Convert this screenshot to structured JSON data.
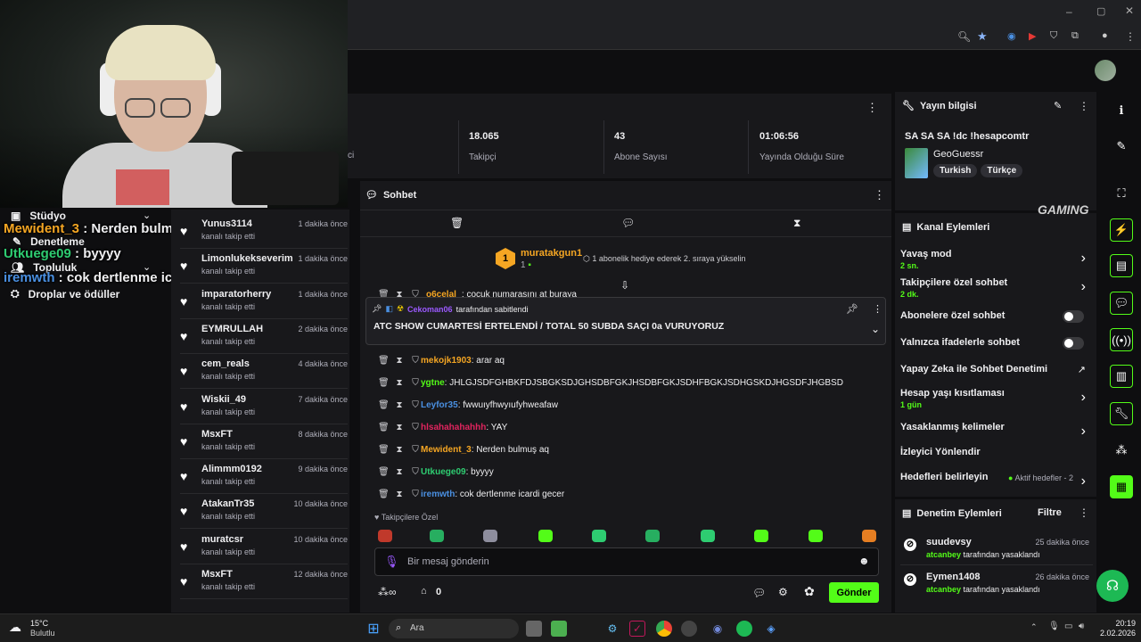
{
  "overlay_chat": [
    {
      "user": "Mewident_3",
      "text": " : Nerden bulmuş aq",
      "color": "#f5a623"
    },
    {
      "user": "Utkuege09",
      "text": " : byyyy",
      "color": "#2ecc71"
    },
    {
      "user": "iremwth",
      "text": " : cok dertlenme icardi gecer",
      "color": "#4a90e2"
    }
  ],
  "left_nav": [
    {
      "label": "Stüdyo",
      "icon": "studio-icon"
    },
    {
      "label": "Denetleme",
      "icon": "moderation-icon"
    },
    {
      "label": "Topluluk",
      "icon": "community-icon"
    },
    {
      "label": "Droplar ve ödüller",
      "icon": "drops-icon"
    }
  ],
  "followers": [
    {
      "name": "Yunus3114",
      "time": "1 dakika önce",
      "sub": "kanalı takip etti"
    },
    {
      "name": "Limonlukekseverim",
      "time": "1 dakika önce",
      "sub": "kanalı takip etti"
    },
    {
      "name": "imparatorherry",
      "time": "1 dakika önce",
      "sub": "kanalı takip etti"
    },
    {
      "name": "EYMRULLAH",
      "time": "2 dakika önce",
      "sub": "kanalı takip etti"
    },
    {
      "name": "cem_reals",
      "time": "4 dakika önce",
      "sub": "kanalı takip etti"
    },
    {
      "name": "Wiskii_49",
      "time": "7 dakika önce",
      "sub": "kanalı takip etti"
    },
    {
      "name": "MsxFT",
      "time": "8 dakika önce",
      "sub": "kanalı takip etti"
    },
    {
      "name": "Alimmm0192",
      "time": "9 dakika önce",
      "sub": "kanalı takip etti"
    },
    {
      "name": "AtakanTr35",
      "time": "10 dakika önce",
      "sub": "kanalı takip etti"
    },
    {
      "name": "muratcsr",
      "time": "10 dakika önce",
      "sub": "kanalı takip etti"
    },
    {
      "name": "MsxFT",
      "time": "12 dakika önce",
      "sub": "kanalı takip etti"
    }
  ],
  "stats": {
    "partial_label": "ci",
    "followers_value": "18.065",
    "followers_label": "Takipçi",
    "subs_value": "43",
    "subs_label": "Abone Sayısı",
    "uptime_value": "01:06:56",
    "uptime_label": "Yayında Olduğu Süre"
  },
  "chat": {
    "title": "Sohbet",
    "gifter_name": "muratakgun1",
    "gifter_count": "1",
    "gifter_rank": "1",
    "gifter_text": "1 abonelik hediye ederek 2. sıraya yükselin",
    "cut_msg_user": "o6celal",
    "cut_msg_text": ": cocuk numarasını at buraya",
    "pinned_by": "Cekoman06",
    "pinned_suffix": " tarafından sabitlendi",
    "pinned_text": "ATC SHOW CUMARTESİ ERTELENDİ / TOTAL 50 SUBDA SAÇI 0a VURUYORUZ",
    "messages": [
      {
        "user": "mekojk1903",
        "text": ": arar aq",
        "color": "#f5a623"
      },
      {
        "user": "ygtne",
        "text": ": JHLGJSDFGHBKFDJSBGKSDJGHSDBFGKJHSDBFGKJSDHFBGKJSDHGSKDJHGSDFJHGBSD",
        "color": "#53fc18"
      },
      {
        "user": "Leyfor35",
        "text": ": fwwuıyfhwyıufyhweafaw",
        "color": "#4a90e2"
      },
      {
        "user": "hlsahahahahhh",
        "text": ": YAY",
        "color": "#e0245e"
      },
      {
        "user": "Mewident_3",
        "text": ": Nerden bulmuş aq",
        "color": "#f5a623"
      },
      {
        "user": "Utkuege09",
        "text": ": byyyy",
        "color": "#2ecc71"
      },
      {
        "user": "iremwth",
        "text": ": cok dertlenme icardi gecer",
        "color": "#4a90e2"
      }
    ],
    "followers_only_label": "Takipçilere Özel",
    "input_placeholder": "Bir mesaj gönderin",
    "points_value": "0",
    "send_label": "Gönder"
  },
  "stream_info": {
    "title": "Yayın bilgisi",
    "stream_title": "SA SA SA !dc !hesapcomtr",
    "category": "GeoGuessr",
    "tags": [
      "Turkish",
      "Türkçe"
    ]
  },
  "channel_actions": {
    "title": "Kanal Eylemleri",
    "items": [
      {
        "label": "Yavaş mod",
        "sub": "2 sn.",
        "control": "chevron"
      },
      {
        "label": "Takipçilere özel sohbet",
        "sub": "2 dk.",
        "control": "chevron"
      },
      {
        "label": "Abonelere özel sohbet",
        "sub": "",
        "control": "toggle"
      },
      {
        "label": "Yalnızca ifadelerle sohbet",
        "sub": "",
        "control": "toggle"
      },
      {
        "label": "Yapay Zeka ile Sohbet Denetimi",
        "sub": "",
        "control": "external"
      },
      {
        "label": "Hesap yaşı kısıtlaması",
        "sub": "1 gün",
        "control": "chevron"
      },
      {
        "label": "Yasaklanmış kelimeler",
        "sub": "",
        "control": "chevron"
      },
      {
        "label": "İzleyici Yönlendir",
        "sub": "",
        "control": "none"
      },
      {
        "label": "Hedefleri belirleyin",
        "sub": "",
        "control": "chevron"
      }
    ],
    "goals_status": "Aktif hedefler - 2"
  },
  "mod_actions": {
    "title": "Denetim Eylemleri",
    "filter_label": "Filtre",
    "items": [
      {
        "user": "suudevsy",
        "time": "25 dakika önce",
        "by": "atcanbey",
        "action": " tarafından yasaklandı"
      },
      {
        "user": "Eymen1408",
        "time": "26 dakika önce",
        "by": "atcanbey",
        "action": " tarafından yasaklandı"
      }
    ]
  },
  "taskbar": {
    "weather_temp": "15°C",
    "weather_desc": "Bulutlu",
    "search_placeholder": "Ara",
    "time": "20:19",
    "date": "2.02.2026"
  },
  "watermark": "GAMING",
  "colors": {
    "accent": "#53fc18",
    "panel": "#18181b",
    "bg": "#0e0e10"
  }
}
